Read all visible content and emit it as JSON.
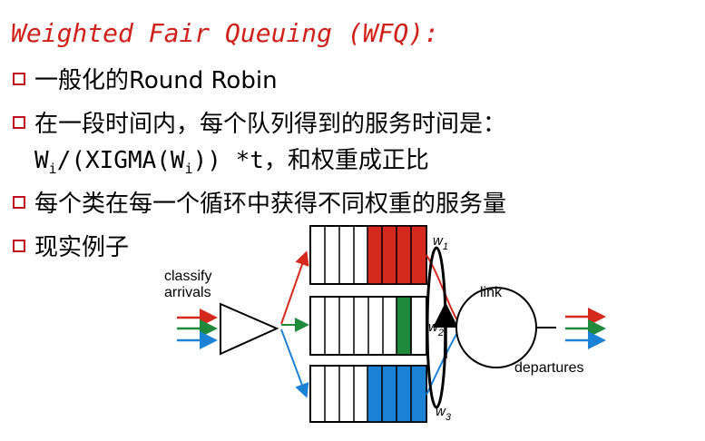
{
  "title": "Weighted Fair Queuing (WFQ):",
  "bullets": [
    "一般化的Round Robin",
    "在一段时间内，每个队列得到的服务时间是：",
    "每个类在每一个循环中获得不同权重的服务量",
    "现实例子"
  ],
  "formula": {
    "w1": "W",
    "sub1": "i",
    "mid": "/(XIGMA(W",
    "sub2": "i",
    "end": ")) *t，和权重成正比"
  },
  "diagram": {
    "classify_label_1": "classify",
    "classify_label_2": "arrivals",
    "link_label": "link",
    "departures_label": "departures",
    "weights": [
      {
        "w": "w",
        "sub": "1"
      },
      {
        "w": "w",
        "sub": "2"
      },
      {
        "w": "w",
        "sub": "3"
      }
    ],
    "colors": {
      "red": "#d42a1e",
      "green": "#1f8a3b",
      "blue": "#1c82d6"
    }
  }
}
